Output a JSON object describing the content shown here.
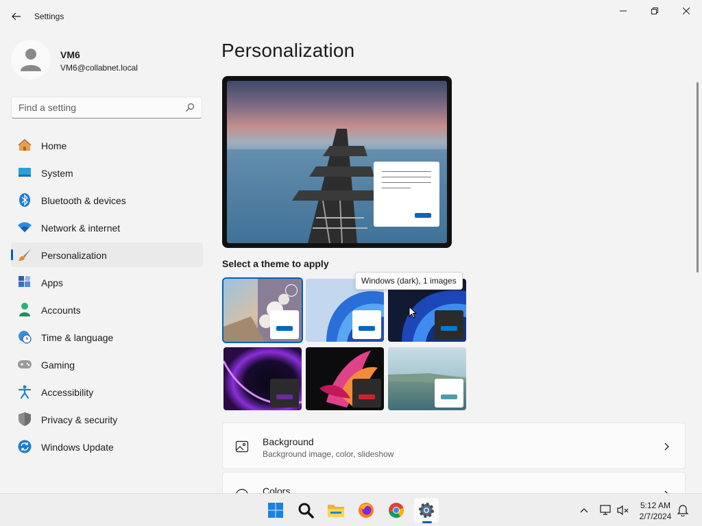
{
  "window": {
    "title": "Settings"
  },
  "profile": {
    "name": "VM6",
    "email": "VM6@collabnet.local"
  },
  "search": {
    "placeholder": "Find a setting"
  },
  "sidebar": {
    "items": [
      {
        "label": "Home",
        "icon": "home-icon"
      },
      {
        "label": "System",
        "icon": "monitor-icon"
      },
      {
        "label": "Bluetooth & devices",
        "icon": "bluetooth-icon"
      },
      {
        "label": "Network & internet",
        "icon": "wifi-icon"
      },
      {
        "label": "Personalization",
        "icon": "brush-icon",
        "selected": true
      },
      {
        "label": "Apps",
        "icon": "apps-icon"
      },
      {
        "label": "Accounts",
        "icon": "person-icon"
      },
      {
        "label": "Time & language",
        "icon": "globe-clock-icon"
      },
      {
        "label": "Gaming",
        "icon": "gamepad-icon"
      },
      {
        "label": "Accessibility",
        "icon": "accessibility-icon"
      },
      {
        "label": "Privacy & security",
        "icon": "shield-icon"
      },
      {
        "label": "Windows Update",
        "icon": "update-icon"
      }
    ]
  },
  "main": {
    "title": "Personalization",
    "themes_label": "Select a theme to apply",
    "tooltip": "Windows (dark), 1 images",
    "cards": [
      {
        "title": "Background",
        "subtitle": "Background image, color, slideshow",
        "icon": "image-icon"
      },
      {
        "title": "Colors",
        "subtitle": "",
        "icon": "palette-icon"
      }
    ]
  },
  "taskbar": {
    "apps": [
      "start-icon",
      "search-icon",
      "file-explorer-icon",
      "firefox-icon",
      "chrome-icon",
      "settings-icon"
    ],
    "time": "5:12 AM",
    "date": "2/7/2024"
  },
  "colors": {
    "accent": "#005fb8",
    "sidebar_selected": "#eaeaea"
  }
}
